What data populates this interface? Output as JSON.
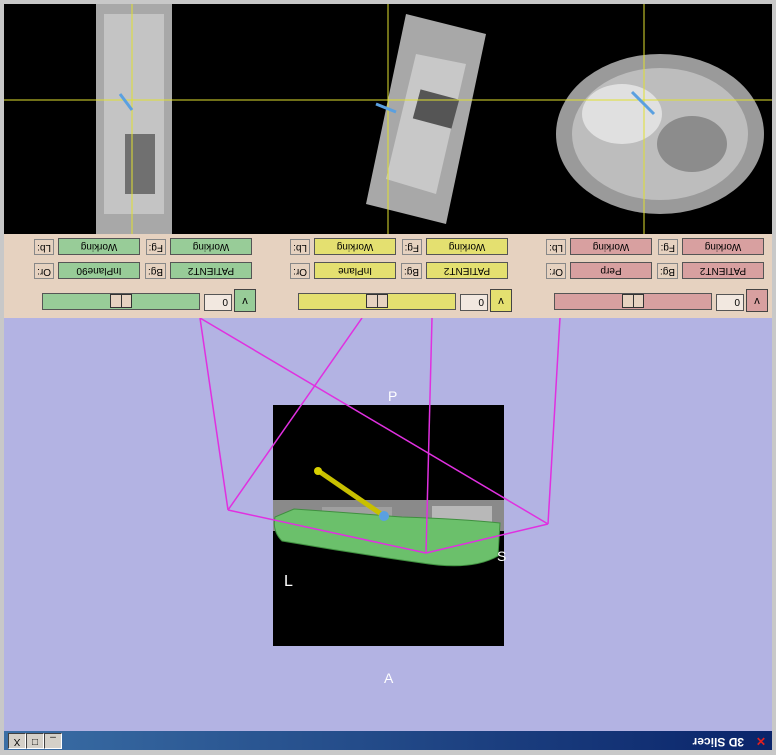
{
  "window": {
    "title": "3D Slicer",
    "minimize": "_",
    "maximize": "□",
    "close": "X"
  },
  "view3d": {
    "labels": {
      "anterior": "A",
      "posterior": "P",
      "left": "L",
      "superior": "S"
    }
  },
  "panels": [
    {
      "id": "red",
      "color": "#d8a0a0",
      "lb_label": "Lb:",
      "lb_value": "Working",
      "fg_label": "Fg:",
      "fg_value": "Working",
      "or_label": "Or:",
      "or_value": "Perp",
      "bg_label": "Bg:",
      "bg_value": "PATIENT2",
      "offset": "0",
      "slider_fraction": 0.5,
      "button": "v"
    },
    {
      "id": "yellow",
      "color": "#e4e070",
      "lb_label": "Lb:",
      "lb_value": "Working",
      "fg_label": "Fg:",
      "fg_value": "Working",
      "or_label": "Or:",
      "or_value": "InPlane",
      "bg_label": "Bg:",
      "bg_value": "PATIENT2",
      "offset": "0",
      "slider_fraction": 0.5,
      "button": "v"
    },
    {
      "id": "green",
      "color": "#98cc98",
      "lb_label": "Lb:",
      "lb_value": "Working",
      "fg_label": "Fg:",
      "fg_value": "Working",
      "or_label": "Or:",
      "or_value": "InPlane90",
      "bg_label": "Bg:",
      "bg_value": "PATIENT2",
      "offset": "0",
      "slider_fraction": 0.5,
      "button": "v"
    }
  ]
}
